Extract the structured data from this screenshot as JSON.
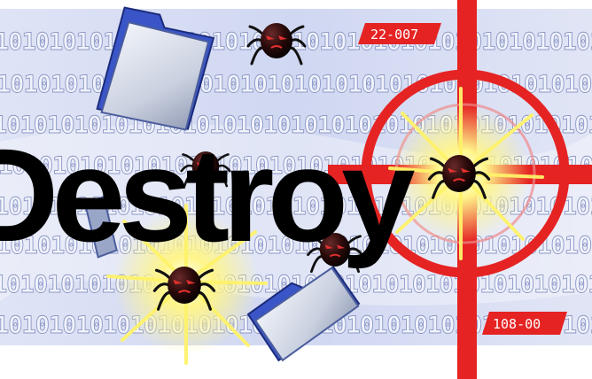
{
  "artwork": {
    "title": "Destroy",
    "binary_rows": [
      "1010101010101010101010101010101010101010101010",
      "1010101010101010101010101010101010101010101010",
      "1010101010101010101010101010101010101010101010",
      "1010101010101010101010101010101010101010101010",
      "1010101010101010101010101010101010101010101010",
      "1010101010101010101010101010101010101010101010",
      "1010101010101010101010101010101010101010101010",
      "1010101010101010101010101010101010101010101010",
      "1010101010101010101010101010101010101010101010"
    ],
    "crosshair_tag_top": "22-007",
    "crosshair_tag_bottom": "108-00",
    "icons": [
      "folder-icon",
      "bug-icon",
      "crosshair-icon",
      "explosion-icon"
    ],
    "colors": {
      "background": "#ffffff",
      "binary_fill": "#eef0f8",
      "band": "#b9c4e8",
      "title": "#000000",
      "crosshair": "#e52323",
      "explosion": "#fff36a",
      "folder": "#3a55c8"
    }
  }
}
